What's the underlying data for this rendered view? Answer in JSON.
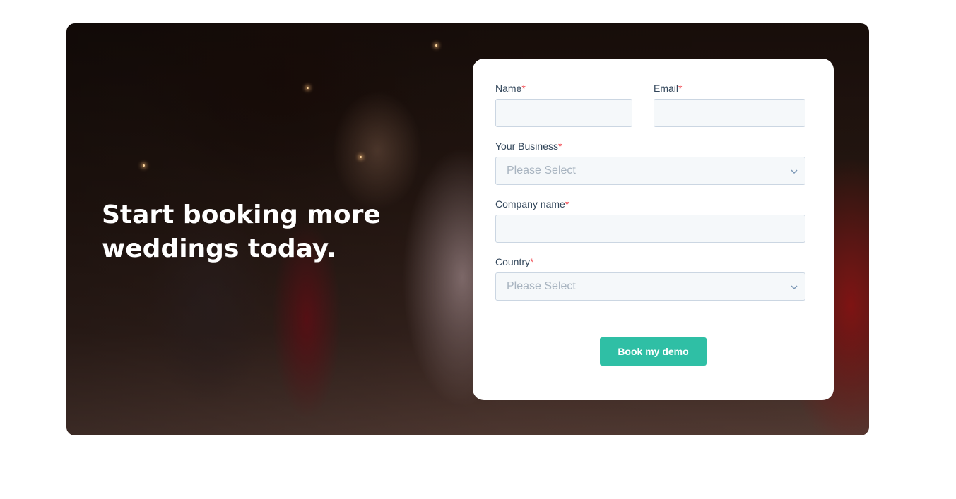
{
  "hero": {
    "headline": "Start booking more weddings today."
  },
  "form": {
    "required_mark": "*",
    "fields": {
      "name": {
        "label": "Name",
        "value": "",
        "placeholder": ""
      },
      "email": {
        "label": "Email",
        "value": "",
        "placeholder": ""
      },
      "business": {
        "label": "Your Business",
        "selected": "Please Select"
      },
      "company": {
        "label": "Company name",
        "value": "",
        "placeholder": ""
      },
      "country": {
        "label": "Country",
        "selected": "Please Select"
      }
    },
    "submit_label": "Book my demo"
  },
  "colors": {
    "accent": "#2fbfa5",
    "required": "#f2545b",
    "label": "#33475b",
    "input_bg": "#f5f8fa",
    "input_border": "#cbd6e2"
  },
  "icons": {
    "select_arrow": "chevron-down-icon"
  }
}
